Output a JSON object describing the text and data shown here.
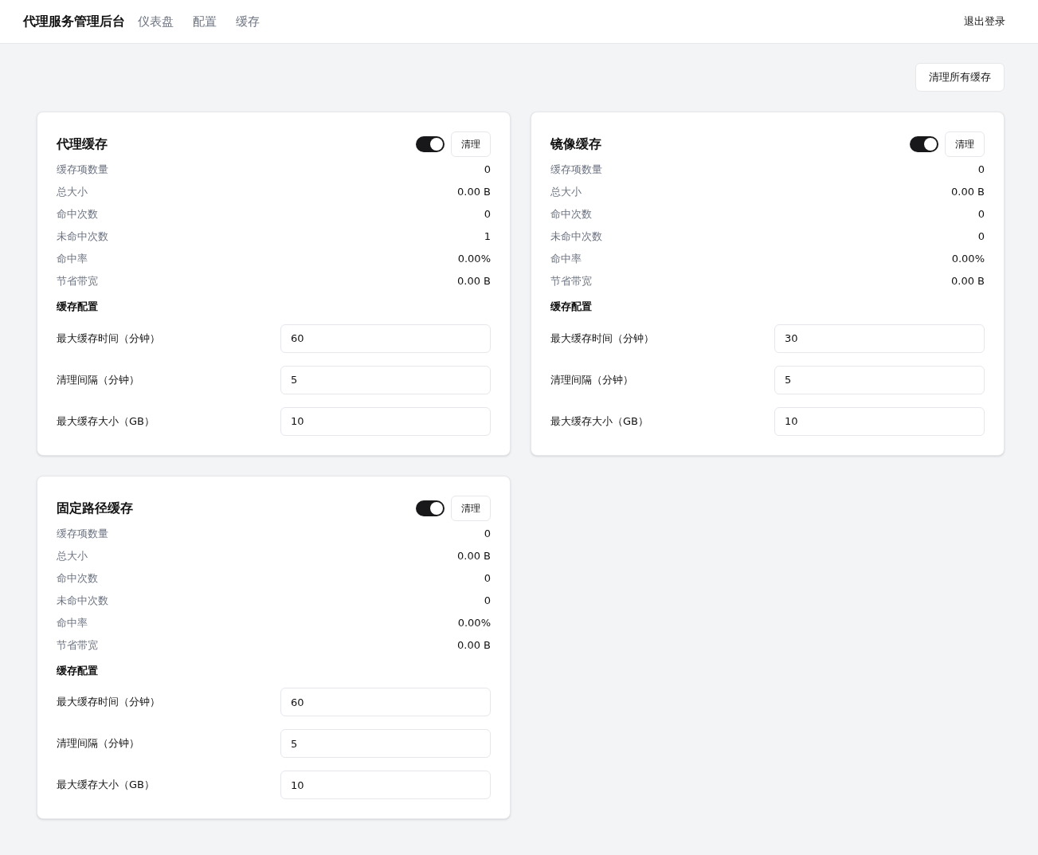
{
  "header": {
    "brand": "代理服务管理后台",
    "nav": [
      "仪表盘",
      "配置",
      "缓存"
    ],
    "logout": "退出登录"
  },
  "clear_all_button": "清理所有缓存",
  "caches": [
    {
      "title": "代理缓存",
      "enabled": true,
      "clear_button": "清理",
      "stats": [
        {
          "label": "缓存项数量",
          "value": "0"
        },
        {
          "label": "总大小",
          "value": "0.00 B"
        },
        {
          "label": "命中次数",
          "value": "0"
        },
        {
          "label": "未命中次数",
          "value": "1"
        },
        {
          "label": "命中率",
          "value": "0.00%"
        },
        {
          "label": "节省带宽",
          "value": "0.00 B"
        }
      ],
      "config_title": "缓存配置",
      "config": [
        {
          "label": "最大缓存时间（分钟）",
          "value": "60"
        },
        {
          "label": "清理间隔（分钟）",
          "value": "5"
        },
        {
          "label": "最大缓存大小（GB）",
          "value": "10"
        }
      ]
    },
    {
      "title": "镜像缓存",
      "enabled": true,
      "clear_button": "清理",
      "stats": [
        {
          "label": "缓存项数量",
          "value": "0"
        },
        {
          "label": "总大小",
          "value": "0.00 B"
        },
        {
          "label": "命中次数",
          "value": "0"
        },
        {
          "label": "未命中次数",
          "value": "0"
        },
        {
          "label": "命中率",
          "value": "0.00%"
        },
        {
          "label": "节省带宽",
          "value": "0.00 B"
        }
      ],
      "config_title": "缓存配置",
      "config": [
        {
          "label": "最大缓存时间（分钟）",
          "value": "30"
        },
        {
          "label": "清理间隔（分钟）",
          "value": "5"
        },
        {
          "label": "最大缓存大小（GB）",
          "value": "10"
        }
      ]
    },
    {
      "title": "固定路径缓存",
      "enabled": true,
      "clear_button": "清理",
      "stats": [
        {
          "label": "缓存项数量",
          "value": "0"
        },
        {
          "label": "总大小",
          "value": "0.00 B"
        },
        {
          "label": "命中次数",
          "value": "0"
        },
        {
          "label": "未命中次数",
          "value": "0"
        },
        {
          "label": "命中率",
          "value": "0.00%"
        },
        {
          "label": "节省带宽",
          "value": "0.00 B"
        }
      ],
      "config_title": "缓存配置",
      "config": [
        {
          "label": "最大缓存时间（分钟）",
          "value": "60"
        },
        {
          "label": "清理间隔（分钟）",
          "value": "5"
        },
        {
          "label": "最大缓存大小（GB）",
          "value": "10"
        }
      ]
    }
  ]
}
